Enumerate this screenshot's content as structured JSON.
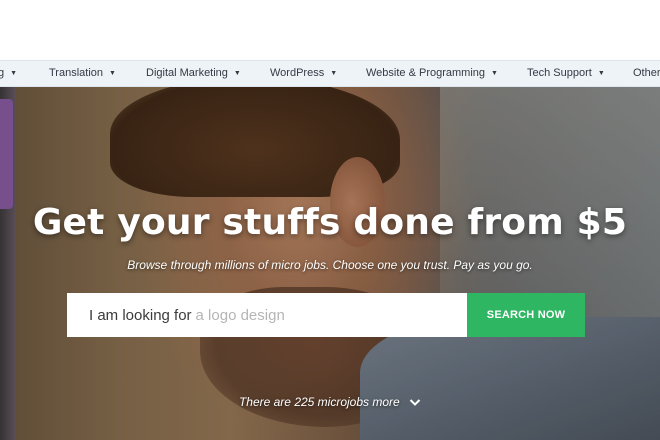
{
  "category_nav": {
    "items": [
      {
        "label": "g",
        "icon": "caret-down-icon"
      },
      {
        "label": "Translation",
        "icon": "caret-down-icon"
      },
      {
        "label": "Digital Marketing",
        "icon": "caret-down-icon"
      },
      {
        "label": "WordPress",
        "icon": "caret-down-icon"
      },
      {
        "label": "Website & Programming",
        "icon": "caret-down-icon"
      },
      {
        "label": "Tech Support",
        "icon": "caret-down-icon"
      },
      {
        "label": "Other",
        "icon": "caret-down-icon"
      }
    ]
  },
  "hero": {
    "headline": "Get your stuffs done from $5",
    "subheadline": "Browse through millions of micro jobs. Choose one you trust. Pay as you go.",
    "search": {
      "prefix": "I am looking for",
      "placeholder": "a logo design",
      "button_label": "SEARCH NOW"
    },
    "more_text": "There are 225 microjobs more",
    "more_icon": "chevron-down-icon"
  },
  "colors": {
    "nav_bg": "#eef3f7",
    "accent_green": "#2fb663",
    "text_white": "#ffffff"
  }
}
